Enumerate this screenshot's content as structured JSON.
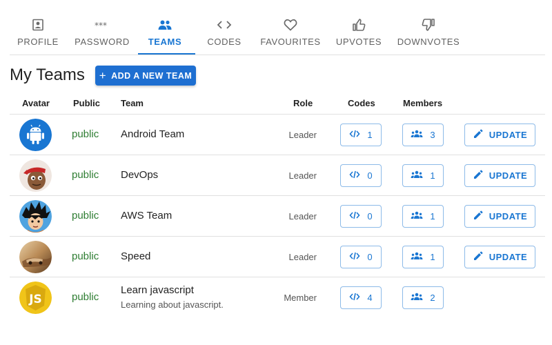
{
  "tabs": [
    {
      "label": "PROFILE",
      "icon": "profile-icon"
    },
    {
      "label": "PASSWORD",
      "icon": "password-icon"
    },
    {
      "label": "TEAMS",
      "icon": "teams-icon",
      "active": true
    },
    {
      "label": "CODES",
      "icon": "code-icon"
    },
    {
      "label": "FAVOURITES",
      "icon": "heart-icon"
    },
    {
      "label": "UPVOTES",
      "icon": "thumbs-up-icon"
    },
    {
      "label": "DOWNVOTES",
      "icon": "thumbs-down-icon"
    }
  ],
  "page": {
    "title": "My Teams",
    "add_button_label": "ADD A NEW TEAM"
  },
  "table": {
    "headers": {
      "avatar": "Avatar",
      "public": "Public",
      "team": "Team",
      "role": "Role",
      "codes": "Codes",
      "members": "Members"
    },
    "rows": [
      {
        "visibility": "public",
        "name": "Android Team",
        "description": "",
        "role": "Leader",
        "codes": "1",
        "members": "3",
        "update_label": "UPDATE"
      },
      {
        "visibility": "public",
        "name": "DevOps",
        "description": "",
        "role": "Leader",
        "codes": "0",
        "members": "1",
        "update_label": "UPDATE"
      },
      {
        "visibility": "public",
        "name": "AWS Team",
        "description": "",
        "role": "Leader",
        "codes": "0",
        "members": "1",
        "update_label": "UPDATE"
      },
      {
        "visibility": "public",
        "name": "Speed",
        "description": "",
        "role": "Leader",
        "codes": "0",
        "members": "1",
        "update_label": "UPDATE"
      },
      {
        "visibility": "public",
        "name": "Learn javascript",
        "description": "Learning about javascript.",
        "role": "Member",
        "codes": "4",
        "members": "2",
        "update_label": ""
      }
    ]
  },
  "colors": {
    "primary": "#1976d2",
    "public_green": "#2e7d32",
    "divider": "#e0e0e0"
  }
}
